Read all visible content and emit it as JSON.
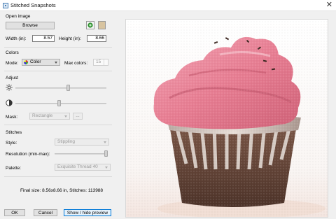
{
  "window": {
    "title": "Stitched Snapshots",
    "close_icon": "✕"
  },
  "open_image": {
    "group_label": "Open image",
    "browse_label": "Browse",
    "width_label": "Width (in):",
    "width_value": "8.57",
    "height_label": "Height (in):",
    "height_value": "8.66"
  },
  "colors": {
    "group_label": "Colors",
    "mode_label": "Mode:",
    "mode_value": "Color",
    "max_colors_label": "Max colors:",
    "max_colors_value": "15"
  },
  "adjust": {
    "group_label": "Adjust",
    "brightness_level": 0.58,
    "contrast_level": 0.48,
    "mask_label": "Mask:",
    "mask_value": "Rectangle",
    "mask_button_label": "..."
  },
  "stitches": {
    "group_label": "Stitches",
    "style_label": "Style:",
    "style_value": "Stippling",
    "resolution_label": "Resolution (min-max):",
    "resolution_level": 0.97,
    "palette_label": "Palette:",
    "palette_value": "Exquisite Thread 40"
  },
  "status": {
    "final_size": "Final size: 8.56x8.66 in, Stitches: 113988"
  },
  "footer": {
    "ok_label": "OK",
    "cancel_label": "Cancel",
    "toggle_preview_label": "Show / hide preview"
  },
  "colors_theme": {
    "accent": "#0078d7",
    "frosting": "#e9788e",
    "cake": "#6b4a3c",
    "wrapper": "#d9cfc6"
  }
}
